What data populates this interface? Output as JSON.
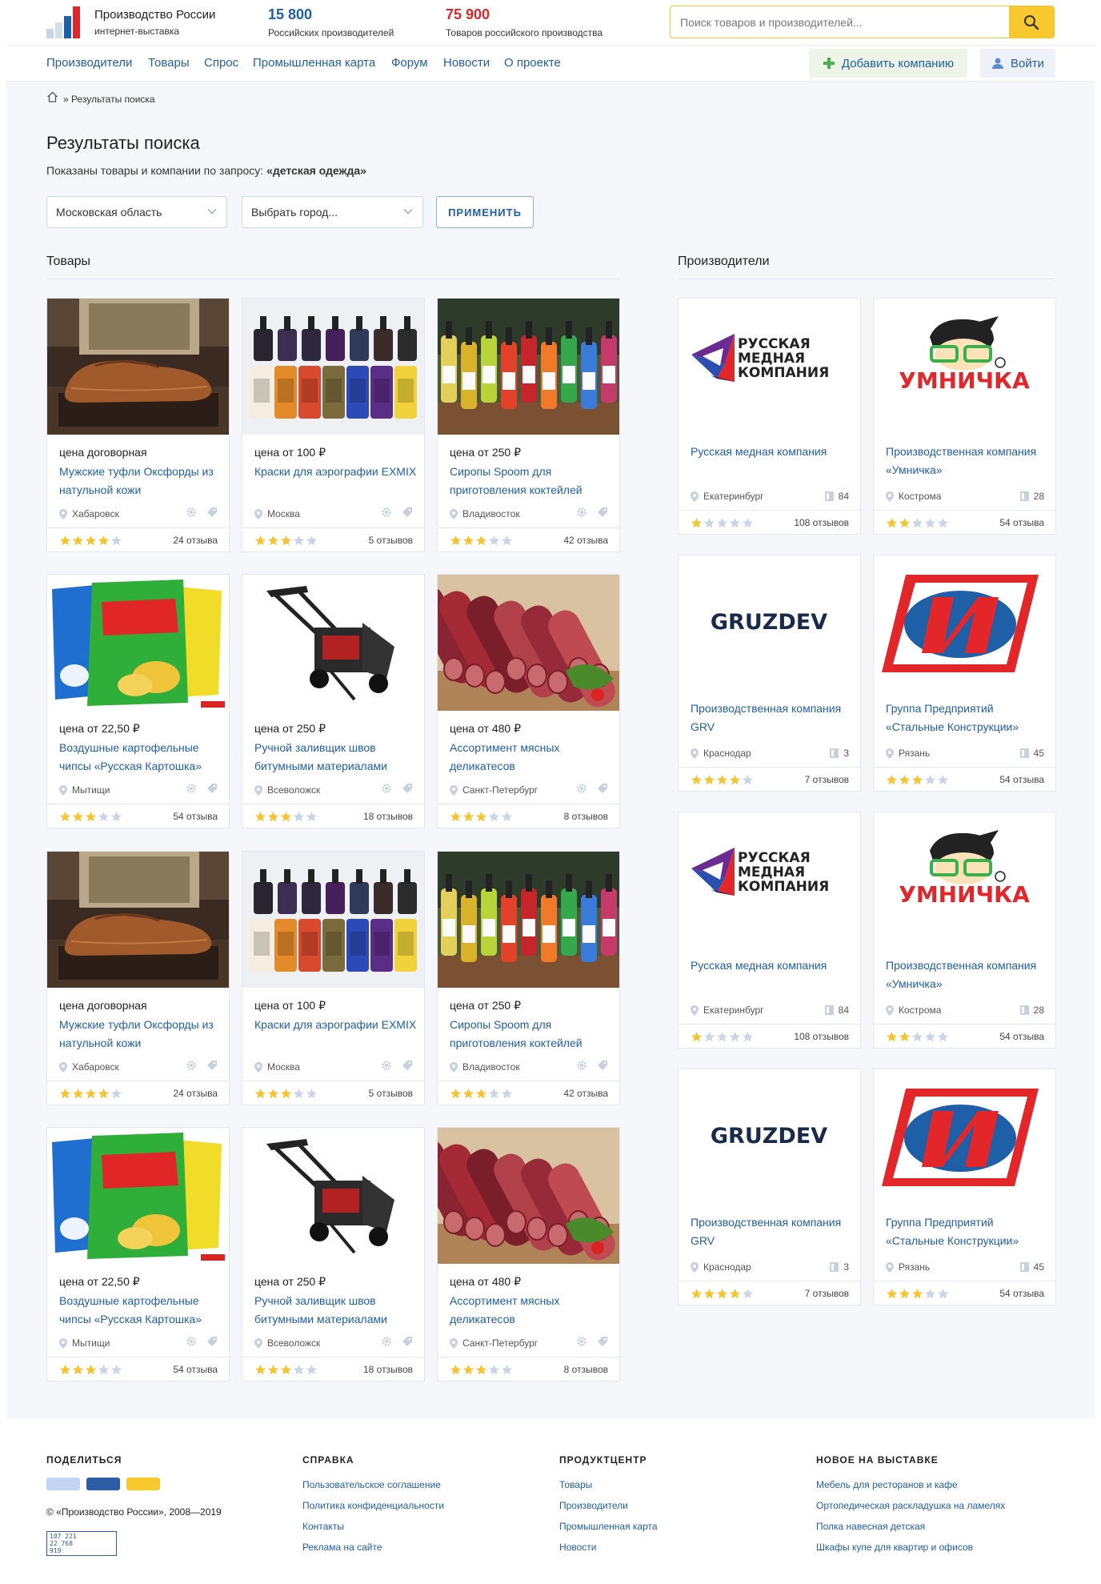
{
  "header": {
    "logo_title": "Производство России",
    "logo_subtitle": "интернет-выставка",
    "stats": [
      {
        "value": "15 800",
        "label": "Российских производителей",
        "color": "#1f5fa8"
      },
      {
        "value": "75 900",
        "label": "Товаров российского производства",
        "color": "#e0262b"
      }
    ],
    "search_placeholder": "Поиск товаров и производителей..."
  },
  "nav": {
    "items": [
      "Производители",
      "Товары",
      "Спрос",
      "Промышленная карта",
      "Форум",
      "Новости",
      "О проекте"
    ],
    "add_company": "Добавить компанию",
    "login": "Войти"
  },
  "breadcrumb": "» Результаты поиска",
  "page": {
    "title": "Результаты поиска",
    "query_prefix": "Показаны товары и компании по запросу:",
    "query": "«детская одежда»",
    "region_select": "Московская область",
    "city_select": "Выбрать город...",
    "apply": "ПРИМЕНИТЬ",
    "products_title": "Товары",
    "makers_title": "Производители"
  },
  "products": [
    {
      "price": "цена договорная",
      "name": "Мужские туфли Оксфорды из натульной кожи",
      "city": "Хабаровск",
      "rating": 4,
      "reviews": "24 отзыва",
      "image": "shoes"
    },
    {
      "price": "цена от 100 ₽",
      "name": "Краски для аэрографии EXMIX",
      "city": "Москва",
      "rating": 3,
      "reviews": "5 отзывов",
      "image": "paints"
    },
    {
      "price": "цена от 250 ₽",
      "name": "Сиропы Spoom для приготовления коктейлей",
      "city": "Владивосток",
      "rating": 3,
      "reviews": "42 отзыва",
      "image": "syrups"
    },
    {
      "price": "цена от 22,50 ₽",
      "name": "Воздушные картофельные чипсы «Русская Картошка»",
      "city": "Мытищи",
      "rating": 3,
      "reviews": "54 отзыва",
      "image": "chips"
    },
    {
      "price": "цена от 250 ₽",
      "name": "Ручной заливщик швов битумными материалами",
      "city": "Всеволожск",
      "rating": 3,
      "reviews": "18 отзывов",
      "image": "machine"
    },
    {
      "price": "цена от 480 ₽",
      "name": "Ассортимент мясных деликатесов",
      "city": "Санкт-Петербург",
      "rating": 3,
      "reviews": "8 отзывов",
      "image": "sausage"
    },
    {
      "price": "цена договорная",
      "name": "Мужские туфли Оксфорды из натульной кожи",
      "city": "Хабаровск",
      "rating": 4,
      "reviews": "24 отзыва",
      "image": "shoes"
    },
    {
      "price": "цена от 100 ₽",
      "name": "Краски для аэрографии EXMIX",
      "city": "Москва",
      "rating": 3,
      "reviews": "5 отзывов",
      "image": "paints"
    },
    {
      "price": "цена от 250 ₽",
      "name": "Сиропы Spoom для приготовления коктейлей",
      "city": "Владивосток",
      "rating": 3,
      "reviews": "42 отзыва",
      "image": "syrups"
    },
    {
      "price": "цена от 22,50 ₽",
      "name": "Воздушные картофельные чипсы «Русская Картошка»",
      "city": "Мытищи",
      "rating": 3,
      "reviews": "54 отзыва",
      "image": "chips"
    },
    {
      "price": "цена от 250 ₽",
      "name": "Ручной заливщик швов битумными материалами",
      "city": "Всеволожск",
      "rating": 3,
      "reviews": "18 отзывов",
      "image": "machine"
    },
    {
      "price": "цена от 480 ₽",
      "name": "Ассортимент мясных деликатесов",
      "city": "Санкт-Петербург",
      "rating": 3,
      "reviews": "8 отзывов",
      "image": "sausage"
    }
  ],
  "makers": [
    {
      "name": "Русская медная компания",
      "city": "Екатеринбург",
      "count": "84",
      "rating": 1,
      "reviews": "108 отзывов",
      "logo": "rmk",
      "logo_text": [
        "РУССКАЯ",
        "МЕДНАЯ",
        "КОМПАНИЯ"
      ]
    },
    {
      "name": "Производственная компания «Умничка»",
      "city": "Кострома",
      "count": "28",
      "rating": 2,
      "reviews": "54 отзыва",
      "logo": "umnichka",
      "logo_text": [
        "УМНИЧКА"
      ]
    },
    {
      "name": "Производственная компания GRV",
      "city": "Краснодар",
      "count": "3",
      "rating": 4,
      "reviews": "7 отзывов",
      "logo": "gruzdev",
      "logo_text": [
        "GRUZDEV"
      ]
    },
    {
      "name": "Группа Предприятий «Стальные Конструкции»",
      "city": "Рязань",
      "count": "45",
      "rating": 3,
      "reviews": "54 отзыва",
      "logo": "steel",
      "logo_text": []
    },
    {
      "name": "Русская медная компания",
      "city": "Екатеринбург",
      "count": "84",
      "rating": 1,
      "reviews": "108 отзывов",
      "logo": "rmk",
      "logo_text": [
        "РУССКАЯ",
        "МЕДНАЯ",
        "КОМПАНИЯ"
      ]
    },
    {
      "name": "Производственная компания «Умничка»",
      "city": "Кострома",
      "count": "28",
      "rating": 2,
      "reviews": "54 отзыва",
      "logo": "umnichka",
      "logo_text": [
        "УМНИЧКА"
      ]
    },
    {
      "name": "Производственная компания GRV",
      "city": "Краснодар",
      "count": "3",
      "rating": 4,
      "reviews": "7 отзывов",
      "logo": "gruzdev",
      "logo_text": [
        "GRUZDEV"
      ]
    },
    {
      "name": "Группа Предприятий «Стальные Конструкции»",
      "city": "Рязань",
      "count": "45",
      "rating": 3,
      "reviews": "54 отзыва",
      "logo": "steel",
      "logo_text": []
    }
  ],
  "footer": {
    "share_title": "ПОДЕЛИТЬСЯ",
    "share_colors": [
      "#c3d5f2",
      "#2e5ca6",
      "#f8c82f"
    ],
    "copyright": "© «Производство России», 2008—2019",
    "counter": [
      "107 221",
      "22 768",
      "919"
    ],
    "columns": [
      {
        "title": "СПРАВКА",
        "links": [
          "Пользовательское соглашение",
          "Политика конфиденциальности",
          "Контакты",
          "Реклама на сайте"
        ]
      },
      {
        "title": "ПРОДУКТЦЕНТР",
        "links": [
          "Товары",
          "Производители",
          "Промышленная карта",
          "Новости"
        ]
      },
      {
        "title": "НОВОЕ НА ВЫСТАВКЕ",
        "links": [
          "Мебель для ресторанов и кафе",
          "Ортопедическая раскладушка на ламелях",
          "Полка навесная детская",
          "Шкафы купе для квартир и офисов"
        ]
      }
    ]
  },
  "colors": {
    "link": "#1f5fa8",
    "accent_yellow": "#f8c82f",
    "star_on": "#f6c431",
    "star_off": "#c9d4e6"
  }
}
